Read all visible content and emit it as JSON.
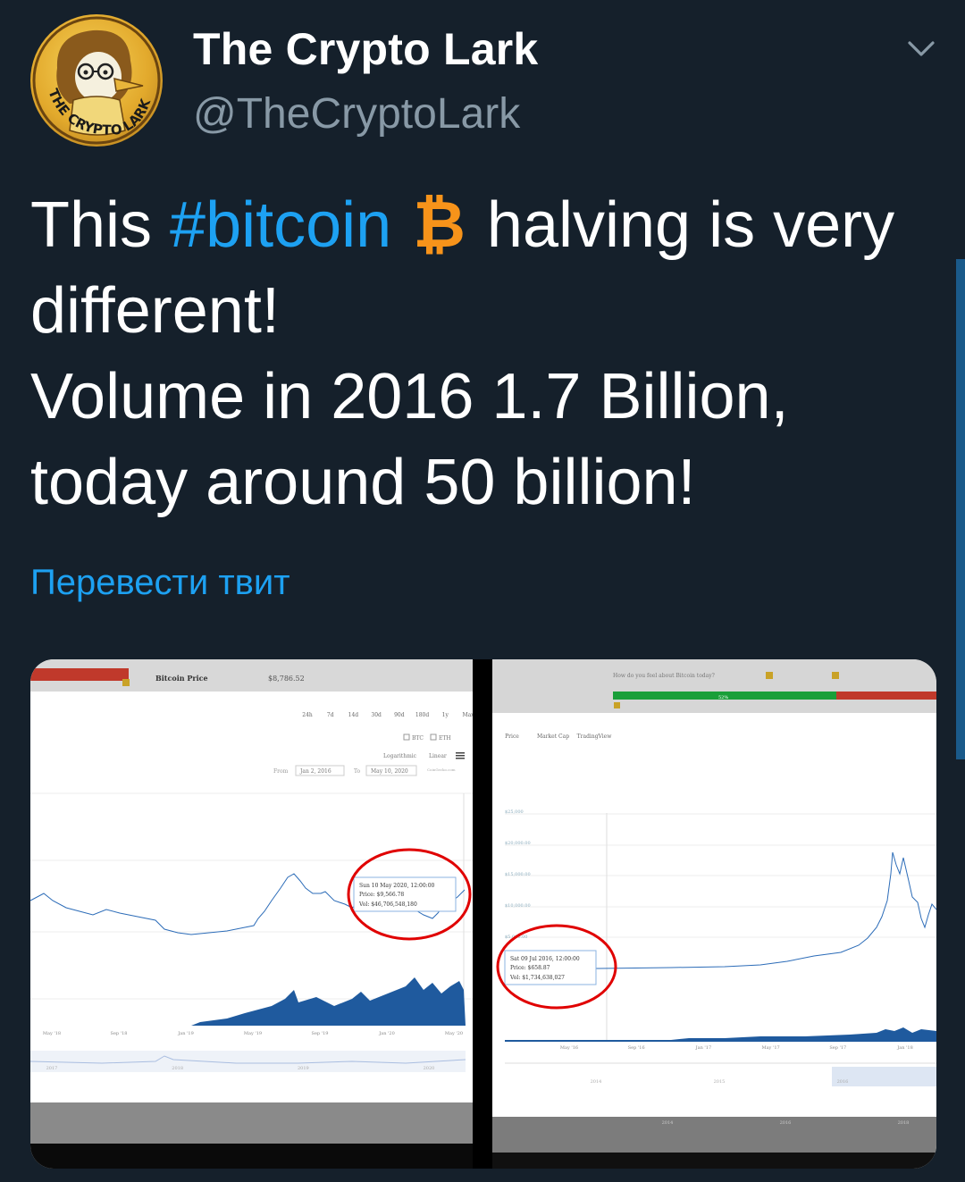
{
  "tweet": {
    "display_name": "The Crypto Lark",
    "handle": "@TheCryptoLark",
    "avatar_text": "THE CRYPTO LARK",
    "text": {
      "part1": "This ",
      "hashtag": "#bitcoin",
      "emoji": "₿",
      "part2": "  halving is very different!",
      "line3": "Volume in 2016 1.7 Billion,",
      "line4": "today around 50 billion!"
    },
    "translate_label": "Перевести твит"
  },
  "icons": {
    "menu": "chevron-down-icon",
    "emoji": "bitcoin-icon"
  },
  "colors": {
    "background": "#15202b",
    "accent": "#1da1f2",
    "secondary_text": "#8899a6",
    "bitcoin": "#f7931a",
    "annotation_circle": "#e00000"
  },
  "media_left": {
    "header_title": "Bitcoin Price",
    "header_price": "$8,786.52",
    "range_tabs": [
      "24h",
      "7d",
      "14d",
      "30d",
      "90d",
      "180d",
      "1y",
      "Max"
    ],
    "compare": [
      "BTC",
      "ETH"
    ],
    "scale_options": [
      "Logarithmic",
      "Linear"
    ],
    "from_label": "From",
    "from_value": "Jan 2, 2016",
    "to_label": "To",
    "to_value": "May 10, 2020",
    "source": "CoinGecko.com",
    "tooltip_date": "Sun 10 May 2020, 12:00:00",
    "tooltip_price": "Price: $9,566.78",
    "tooltip_vol": "Vol: $46,706,548,180",
    "x_ticks": [
      "May '18",
      "Sep '18",
      "Jan '19",
      "May '19",
      "Sep '19",
      "Jan '20",
      "May '20"
    ],
    "navigator_years": [
      "2017",
      "2018",
      "2019",
      "2020"
    ]
  },
  "media_right": {
    "poll_question": "How do you feel about Bitcoin today?",
    "poll_percent": "52%",
    "tabs": [
      "Price",
      "Market Cap",
      "TradingView"
    ],
    "y_ticks": [
      "$25,000",
      "$20,000.00",
      "$15,000.00",
      "$10,000.00",
      "$5,000.00"
    ],
    "tooltip_date": "Sat 09 Jul 2016, 12:00:00",
    "tooltip_price": "Price: $658.87",
    "tooltip_vol": "Vol: $1,734,638,027",
    "x_ticks": [
      "May '16",
      "Sep '16",
      "Jan '17",
      "May '17",
      "Sep '17",
      "Jan '18"
    ],
    "navigator_years": [
      "2014",
      "2015",
      "2016"
    ],
    "bottom_years": [
      "2014",
      "2016",
      "2018"
    ]
  }
}
